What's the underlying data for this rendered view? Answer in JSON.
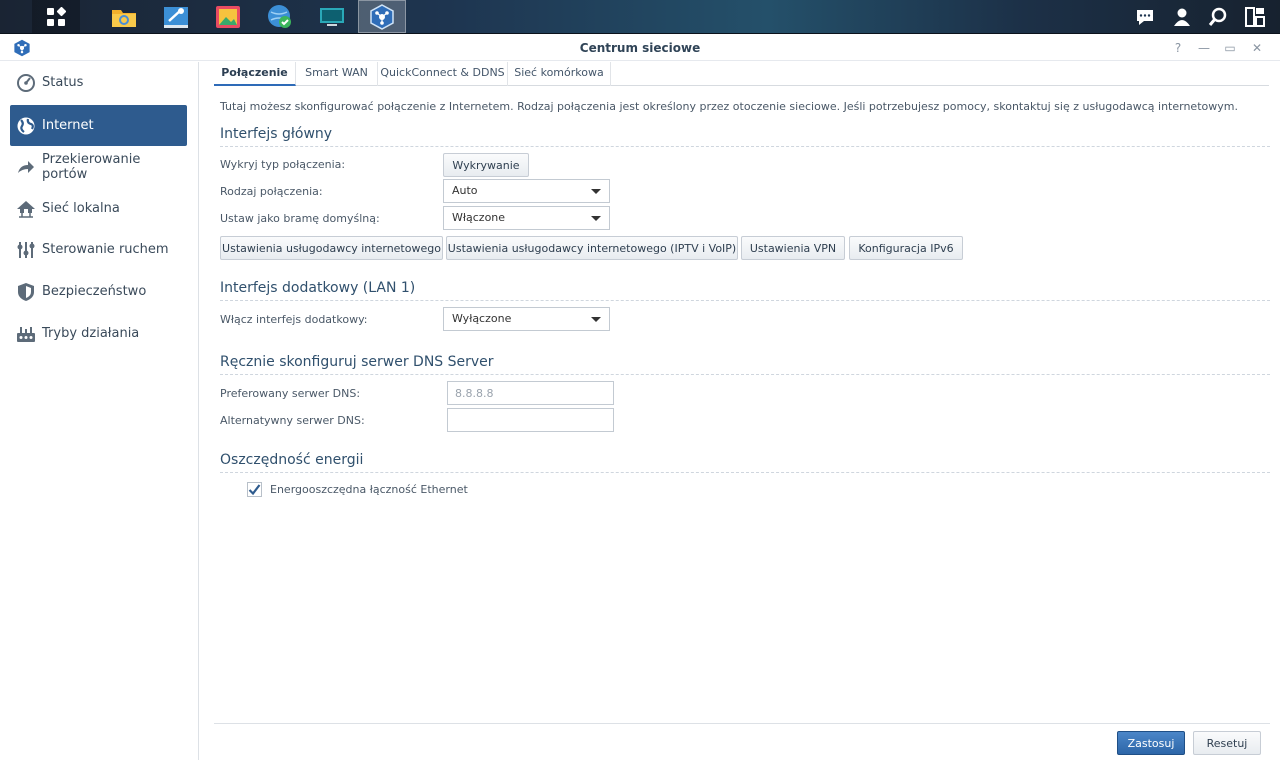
{
  "taskbar": {
    "apps": [
      {
        "icon": "main-menu-icon"
      },
      {
        "icon": "file-station-icon"
      },
      {
        "icon": "control-panel-icon"
      },
      {
        "icon": "photo-station-icon"
      },
      {
        "icon": "web-station-icon"
      },
      {
        "icon": "terminal-icon"
      },
      {
        "icon": "network-center-icon"
      }
    ],
    "right_icons": [
      "chat-icon",
      "user-icon",
      "search-icon",
      "widgets-icon"
    ]
  },
  "window": {
    "title": "Centrum sieciowe",
    "controls": [
      "?",
      "—",
      "▭",
      "✕"
    ]
  },
  "sidebar": {
    "items": [
      {
        "label": "Status",
        "icon": "status-icon"
      },
      {
        "label": "Internet",
        "icon": "globe-icon"
      },
      {
        "label": "Przekierowanie portów",
        "icon": "port-forward-icon"
      },
      {
        "label": "Sieć lokalna",
        "icon": "home-network-icon"
      },
      {
        "label": "Sterowanie ruchem",
        "icon": "traffic-control-icon"
      },
      {
        "label": "Bezpieczeństwo",
        "icon": "shield-icon"
      },
      {
        "label": "Tryby działania",
        "icon": "operation-mode-icon"
      }
    ],
    "active_index": 1
  },
  "tabs": [
    "Połączenie",
    "Smart WAN",
    "QuickConnect & DDNS",
    "Sieć komórkowa"
  ],
  "intro": "Tutaj możesz skonfigurować połączenie z Internetem. Rodzaj połączenia jest określony przez otoczenie sieciowe. Jeśli potrzebujesz pomocy, skontaktuj się z usługodawcą internetowym.",
  "primary": {
    "title": "Interfejs główny",
    "detect_label": "Wykryj typ połączenia:",
    "detect_button": "Wykrywanie",
    "conn_type_label": "Rodzaj połączenia:",
    "conn_type_value": "Auto",
    "gateway_label": "Ustaw jako bramę domyślną:",
    "gateway_value": "Włączone",
    "buttons": [
      "Ustawienia usługodawcy internetowego",
      "Ustawienia usługodawcy internetowego (IPTV i VoIP)",
      "Ustawienia VPN",
      "Konfiguracja IPv6"
    ]
  },
  "secondary": {
    "title": "Interfejs dodatkowy (LAN 1)",
    "enable_label": "Włącz interfejs dodatkowy:",
    "enable_value": "Wyłączone"
  },
  "dns": {
    "title": "Ręcznie skonfiguruj serwer DNS Server",
    "preferred_label": "Preferowany serwer DNS:",
    "preferred_placeholder": "8.8.8.8",
    "alternate_label": "Alternatywny serwer DNS:",
    "alternate_value": ""
  },
  "energy": {
    "title": "Oszczędność energii",
    "checkbox_label": "Energooszczędna łączność Ethernet",
    "checked": true
  },
  "footer": {
    "apply": "Zastosuj",
    "reset": "Resetuj"
  }
}
